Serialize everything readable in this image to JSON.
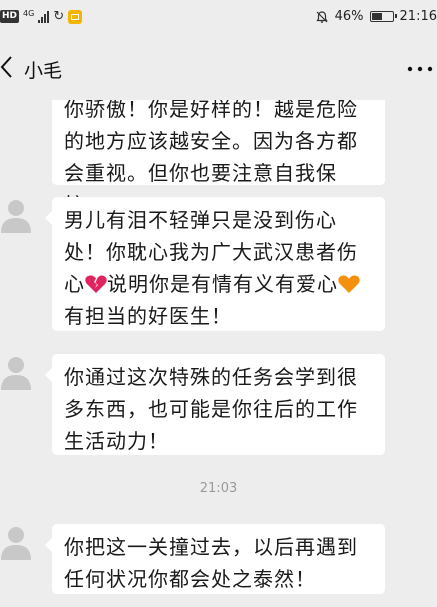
{
  "status_bar": {
    "hd": "HD",
    "network": "4G",
    "battery_text": "46%",
    "battery_level": 0.46,
    "time": "21:16"
  },
  "header": {
    "title": "小毛",
    "more_label": "…"
  },
  "messages": [
    {
      "id": "m1",
      "text": "你骄傲！你是好样的！越是危险的地方应该越安全。因为各方都会重视。但你也要注意自我保护！"
    },
    {
      "id": "m2",
      "text_part1": "男儿有泪不轻弹只是没到伤心处！你耽心我为广大武汉患者伤心",
      "emoji1": "broken-heart-icon",
      "text_part2": "说明你是有情有义有爱心",
      "emoji2": "orange-heart-icon",
      "text_part3": "有担当的好医生！"
    },
    {
      "id": "m3",
      "text": "你通过这次特殊的任务会学到很多东西，也可能是你往后的工作生活动力！"
    },
    {
      "id": "m4",
      "text": "你把这一关撞过去，以后再遇到任何状况你都会处之泰然！"
    }
  ],
  "timestamp": "21:03",
  "colors": {
    "background": "#ededed",
    "bubble": "#ffffff",
    "avatar": "#c8c8c8",
    "broken_heart": "#e0245e",
    "orange_heart": "#f4900c"
  }
}
